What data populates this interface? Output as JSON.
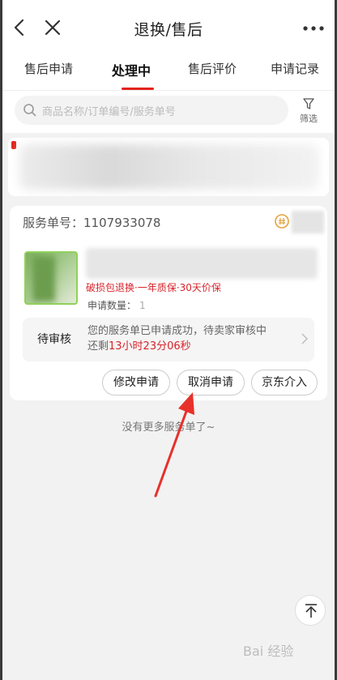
{
  "header": {
    "title": "退换/售后"
  },
  "tabs": [
    {
      "label": "售后申请",
      "active": false
    },
    {
      "label": "处理中",
      "active": true
    },
    {
      "label": "售后评价",
      "active": false
    },
    {
      "label": "申请记录",
      "active": false
    }
  ],
  "search": {
    "placeholder": "商品名称/订单编号/服务单号",
    "filter_label": "筛选"
  },
  "service_card": {
    "service_no_label": "服务单号：",
    "service_no": "1107933078",
    "service_tags": "破损包退换·一年质保·30天价保",
    "quantity_label": "申请数量：",
    "quantity_value": "1",
    "status": {
      "label": "待审核",
      "message": "您的服务单已申请成功，待卖家审核中",
      "countdown_prefix": "还剩",
      "countdown": "13小时23分06秒"
    },
    "buttons": {
      "modify": "修改申请",
      "cancel": "取消申请",
      "jd_intervene": "京东介入"
    }
  },
  "footer": {
    "no_more": "没有更多服务单了~"
  },
  "watermark": "Bai 经验",
  "colors": {
    "accent": "#e2231a",
    "status_red": "#d8232a",
    "annotation_arrow": "#e8302a"
  }
}
